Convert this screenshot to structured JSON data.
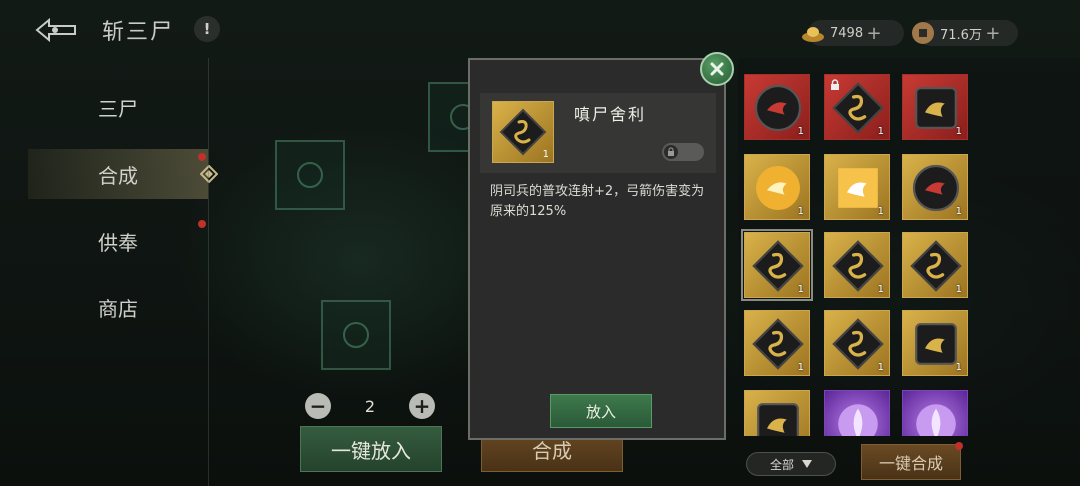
{
  "header": {
    "title": "斩三尸",
    "help_label": "!",
    "currencies": [
      {
        "icon": "gold-ingot-icon",
        "value": "7498"
      },
      {
        "icon": "copper-coin-icon",
        "value": "71.6万"
      }
    ]
  },
  "sidebar": {
    "items": [
      {
        "label": "三尸",
        "active": false,
        "badge": false
      },
      {
        "label": "合成",
        "active": true,
        "badge": true
      },
      {
        "label": "供奉",
        "active": false,
        "badge": true
      },
      {
        "label": "商店",
        "active": false,
        "badge": false
      }
    ]
  },
  "compose": {
    "quantity": "2",
    "put_all_label": "一键放入",
    "compose_label": "合成"
  },
  "modal": {
    "item_name": "嗔尸舍利",
    "item_count": "1",
    "description": "阴司兵的普攻连射+2，弓箭伤害变为原来的125%",
    "put_label": "放入"
  },
  "inventory": {
    "items": [
      {
        "color": "red",
        "icon": "bird-orb-icon",
        "count": "1",
        "locked": false
      },
      {
        "color": "red",
        "icon": "serpent-diamond-icon",
        "count": "1",
        "locked": true
      },
      {
        "color": "red",
        "icon": "bird-square-icon",
        "count": "1",
        "locked": false
      },
      {
        "color": "gold",
        "icon": "sun-bird-icon",
        "count": "1",
        "locked": false
      },
      {
        "color": "gold",
        "icon": "bird-burst-icon",
        "count": "1",
        "locked": false
      },
      {
        "color": "gold",
        "icon": "bird-orb-icon",
        "count": "1",
        "locked": false
      },
      {
        "color": "gold",
        "icon": "serpent-diamond-icon",
        "count": "1",
        "locked": false,
        "selected": true
      },
      {
        "color": "gold",
        "icon": "serpent-diamond-icon",
        "count": "1",
        "locked": false
      },
      {
        "color": "gold",
        "icon": "serpent-diamond-icon",
        "count": "1",
        "locked": false
      },
      {
        "color": "gold",
        "icon": "serpent-diamond-icon",
        "count": "1",
        "locked": false
      },
      {
        "color": "gold",
        "icon": "serpent-diamond-icon",
        "count": "1",
        "locked": false
      },
      {
        "color": "gold",
        "icon": "bird-square-icon",
        "count": "1",
        "locked": false
      },
      {
        "color": "gold",
        "icon": "bird-square-icon",
        "count": "",
        "locked": false
      },
      {
        "color": "purple",
        "icon": "purple-flame-icon",
        "count": "",
        "locked": false
      },
      {
        "color": "purple",
        "icon": "purple-flame-icon",
        "count": "",
        "locked": false
      }
    ],
    "filter_label": "全部",
    "compose_all_label": "一键合成"
  },
  "colors": {
    "accent_green": "#3e7a4c",
    "accent_gold": "#d9b24a",
    "accent_red": "#c93a34",
    "badge_red": "#c0312b"
  }
}
